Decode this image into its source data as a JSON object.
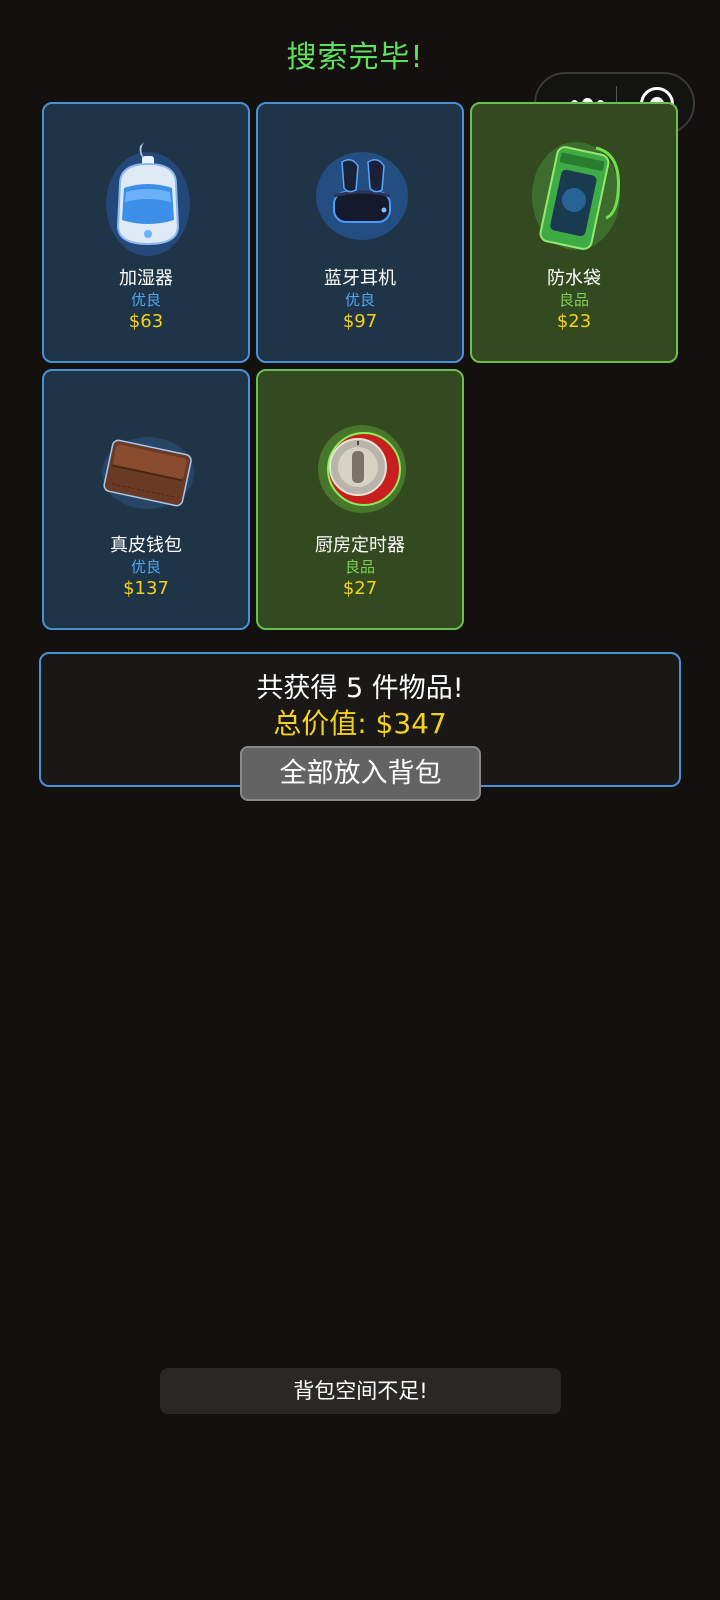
{
  "title": "搜索完毕!",
  "capsule": {
    "more_icon": "more-dots-icon",
    "close_icon": "target-circle-icon"
  },
  "items": [
    {
      "name": "加湿器",
      "rarity": "优良",
      "price": "$63",
      "tier": "fine",
      "icon": "humidifier-icon"
    },
    {
      "name": "蓝牙耳机",
      "rarity": "优良",
      "price": "$97",
      "tier": "fine",
      "icon": "earbuds-icon"
    },
    {
      "name": "防水袋",
      "rarity": "良品",
      "price": "$23",
      "tier": "good",
      "icon": "waterproof-bag-icon"
    },
    {
      "name": "真皮钱包",
      "rarity": "优良",
      "price": "$137",
      "tier": "fine",
      "icon": "wallet-icon"
    },
    {
      "name": "厨房定时器",
      "rarity": "良品",
      "price": "$27",
      "tier": "good",
      "icon": "kitchen-timer-icon"
    }
  ],
  "summary": {
    "count_text": "共获得 5 件物品!",
    "total_text": "总价值: $347"
  },
  "put_all_button": "全部放入背包",
  "toast": "背包空间不足!",
  "colors": {
    "background": "#13100d",
    "title_green": "#5ee05e",
    "fine_border": "#4a90d9",
    "fine_bg": "#1f3447",
    "good_border": "#6bbf4e",
    "good_bg": "#33491f",
    "price_yellow": "#f2d21b"
  }
}
